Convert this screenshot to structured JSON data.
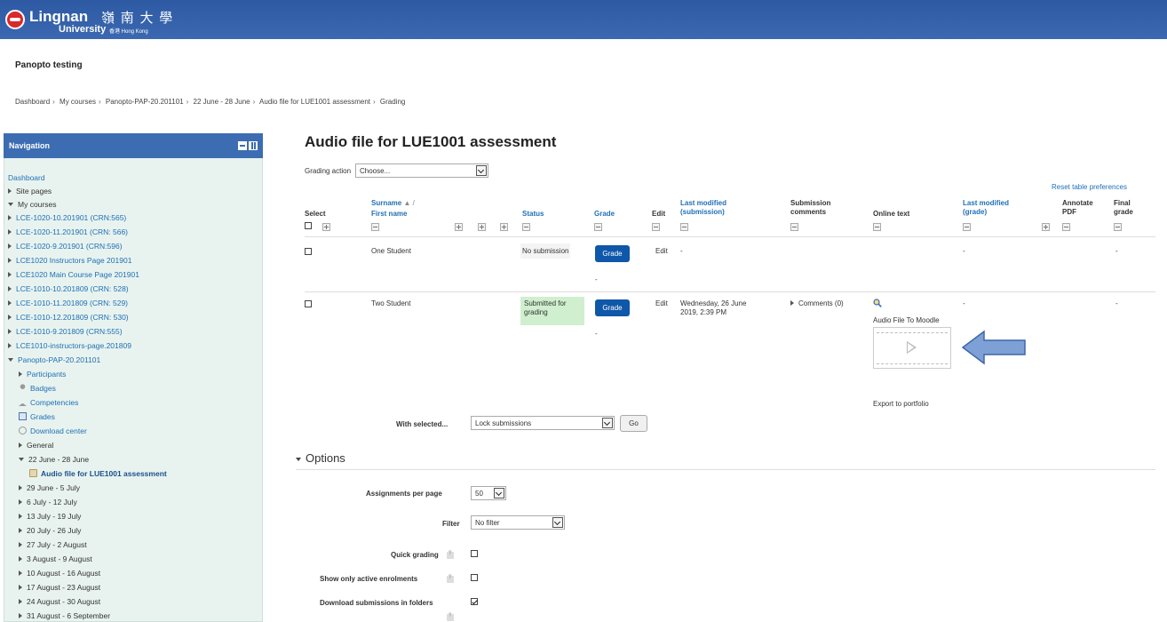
{
  "header": {
    "logo_main": "Lingnan",
    "logo_cjk": "嶺 南 大 學",
    "logo_sub": "University",
    "logo_sub2": "香港 Hong Kong",
    "colors": {
      "bar": "#3c6db2",
      "logo_red": "#d9292a"
    }
  },
  "course_title": "Panopto testing",
  "breadcrumb": [
    "Dashboard",
    "My courses",
    "Panopto-PAP-20.201101",
    "22 June - 28 June",
    "Audio file for LUE1001 assessment",
    "Grading"
  ],
  "nav": {
    "title": "Navigation",
    "items": [
      {
        "label": "Dashboard"
      },
      {
        "label": "Site pages"
      },
      {
        "label": "My courses"
      },
      {
        "label": "LCE-1020-10.201901 (CRN:565)"
      },
      {
        "label": "LCE-1020-11.201901 (CRN: 566)"
      },
      {
        "label": "LCE-1020-9.201901 (CRN:596)"
      },
      {
        "label": "LCE1020 Instructors Page 201901"
      },
      {
        "label": "LCE1020 Main Course Page 201901"
      },
      {
        "label": "LCE-1010-10.201809 (CRN: 528)"
      },
      {
        "label": "LCE-1010-11.201809 (CRN: 529)"
      },
      {
        "label": "LCE-1010-12.201809 (CRN: 530)"
      },
      {
        "label": "LCE-1010-9.201809 (CRN:555)"
      },
      {
        "label": "LCE1010-instructors-page.201809"
      },
      {
        "label": "Panopto-PAP-20.201101"
      },
      {
        "label": "Participants"
      },
      {
        "label": "Badges"
      },
      {
        "label": "Competencies"
      },
      {
        "label": "Grades"
      },
      {
        "label": "Download center"
      },
      {
        "label": "General"
      },
      {
        "label": "22 June - 28 June"
      },
      {
        "label": "Audio file for LUE1001 assessment"
      },
      {
        "label": "29 June - 5 July"
      },
      {
        "label": "6 July - 12 July"
      },
      {
        "label": "13 July - 19 July"
      },
      {
        "label": "20 July - 26 July"
      },
      {
        "label": "27 July - 2 August"
      },
      {
        "label": "3 August - 9 August"
      },
      {
        "label": "10 August - 16 August"
      },
      {
        "label": "17 August - 23 August"
      },
      {
        "label": "24 August - 30 August"
      },
      {
        "label": "31 August - 6 September"
      }
    ]
  },
  "main": {
    "title": "Audio file for LUE1001 assessment",
    "grading_action_label": "Grading action",
    "grading_action_value": "Choose...",
    "reset_prefs": "Reset table preferences",
    "columns": {
      "select": "Select",
      "surname": "Surname",
      "surname_sort": "▲ /",
      "first_name": "First name",
      "status": "Status",
      "grade": "Grade",
      "edit": "Edit",
      "last_modified_sub_1": "Last modified",
      "last_modified_sub_2": "(submission)",
      "sub_comments_1": "Submission",
      "sub_comments_2": "comments",
      "online_text": "Online text",
      "last_modified_grade_1": "Last modified",
      "last_modified_grade_2": "(grade)",
      "annotate_1": "Annotate",
      "annotate_2": "PDF",
      "final_1": "Final",
      "final_2": "grade"
    },
    "rows": [
      {
        "name": "One Student",
        "status": "No submission",
        "grade_btn": "Grade",
        "grade_value": "-",
        "edit": "Edit",
        "last_modified": "-",
        "last_modified_grade": "-",
        "final_grade": "-"
      },
      {
        "name": "Two Student",
        "status_1": "Submitted for",
        "status_2": "grading",
        "grade_btn": "Grade",
        "grade_value": "-",
        "edit": "Edit",
        "last_modified_1": "Wednesday, 26 June",
        "last_modified_2": "2019, 2:39 PM",
        "comments": "Comments (0)",
        "online_text_link": "Audio File To Moodle",
        "export": "Export to portfolio",
        "last_modified_grade": "-",
        "final_grade": "-"
      }
    ],
    "with_selected_label": "With selected...",
    "with_selected_value": "Lock submissions",
    "go": "Go",
    "options": {
      "title": "Options",
      "assignments_per_page_label": "Assignments per page",
      "assignments_per_page_value": "50",
      "filter_label": "Filter",
      "filter_value": "No filter",
      "quick_grading": "Quick grading",
      "show_active": "Show only active enrolments",
      "download_folders": "Download submissions in folders"
    }
  }
}
